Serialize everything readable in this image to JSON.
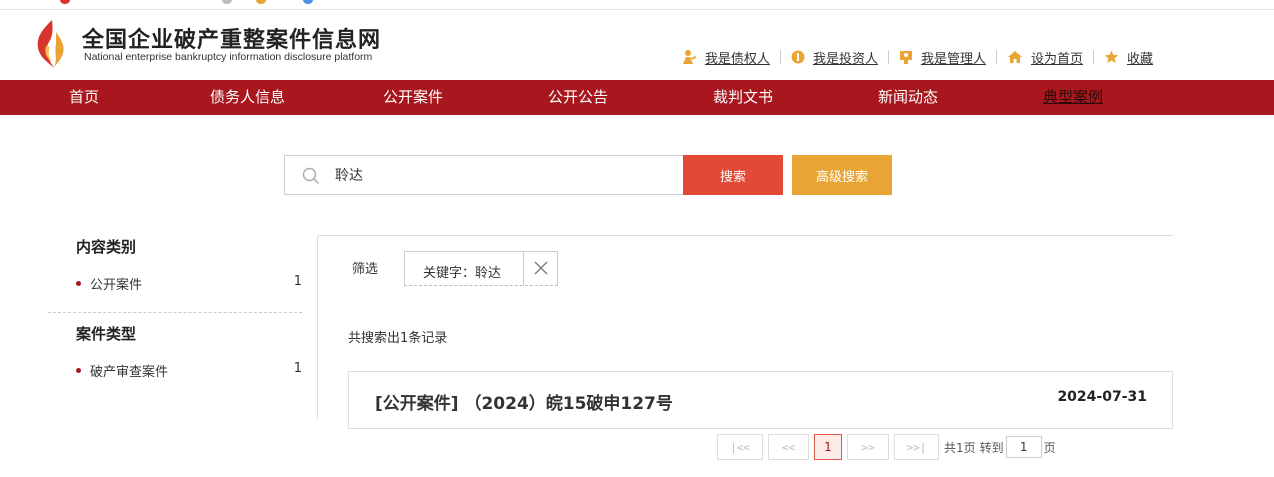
{
  "site": {
    "title": "全国企业破产重整案件信息网",
    "subtitle": "National enterprise bankruptcy  information disclosure platform"
  },
  "toplinks": [
    {
      "label": "我是债权人",
      "icon": "creditor-icon"
    },
    {
      "label": "我是投资人",
      "icon": "investor-icon"
    },
    {
      "label": "我是管理人",
      "icon": "administrator-icon"
    },
    {
      "label": "设为首页",
      "icon": "home-icon"
    },
    {
      "label": "收藏",
      "icon": "star-icon"
    }
  ],
  "nav": [
    {
      "label": "首页"
    },
    {
      "label": "债务人信息"
    },
    {
      "label": "公开案件"
    },
    {
      "label": "公开公告"
    },
    {
      "label": "裁判文书"
    },
    {
      "label": "新闻动态"
    },
    {
      "label": "典型案例",
      "active": true
    }
  ],
  "search": {
    "value": "聆达",
    "search_label": "搜索",
    "advanced_label": "高级搜索"
  },
  "sidebar": {
    "sections": [
      {
        "heading": "内容类别",
        "items": [
          {
            "label": "公开案件",
            "count": "1"
          }
        ]
      },
      {
        "heading": "案件类型",
        "items": [
          {
            "label": "破产审查案件",
            "count": "1"
          }
        ]
      }
    ]
  },
  "filter": {
    "label": "筛选",
    "chip": "关键字：聆达"
  },
  "results": {
    "count_text": "共搜索出1条记录",
    "items": [
      {
        "title": "[公开案件] （2024）皖15破申127号",
        "date": "2024-07-31"
      }
    ]
  },
  "pager": {
    "first": "|<<",
    "prev": "<<",
    "current": "1",
    "next": ">>",
    "last": ">>|",
    "total_text": "共1页",
    "goto_text": "转到",
    "goto_value": "1",
    "page_unit": "页"
  },
  "colors": {
    "nav_bg": "#a8171d",
    "search_btn": "#e24a37",
    "advanced_btn": "#e8a535"
  }
}
